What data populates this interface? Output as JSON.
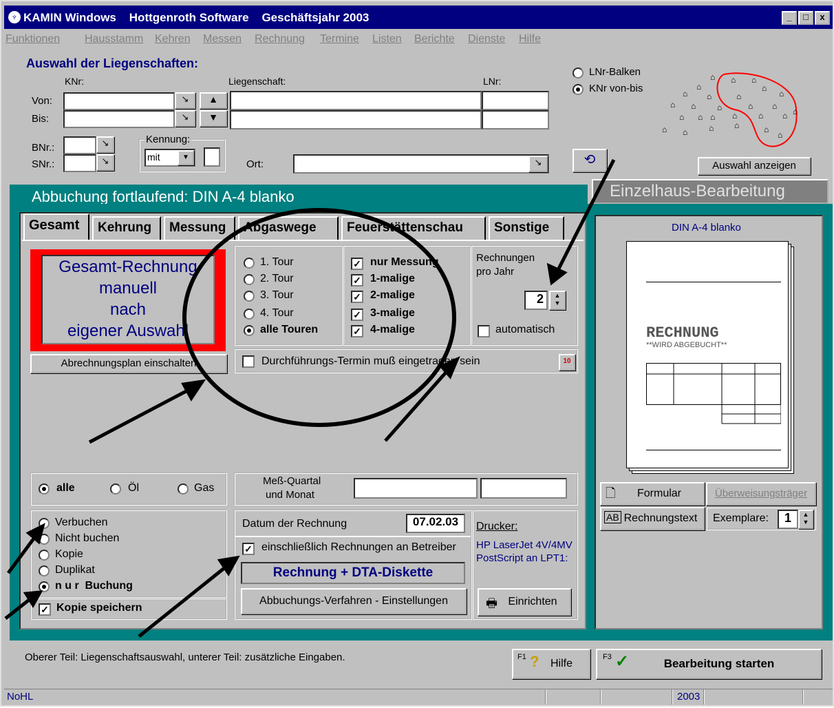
{
  "window": {
    "title": "KAMIN Windows    Hottgenroth Software    Geschäftsjahr 2003",
    "min": "_",
    "max": "□",
    "close": "x"
  },
  "menu": [
    "Funktionen",
    "Hausstamm",
    "Kehren",
    "Messen",
    "Rechnung",
    "Termine",
    "Listen",
    "Berichte",
    "Dienste",
    "Hilfe"
  ],
  "selection": {
    "heading": "Auswahl der Liegenschaften:",
    "col_knr": "KNr:",
    "col_liegenschaft": "Liegenschaft:",
    "col_lnr": "LNr:",
    "von": "Von:",
    "bis": "Bis:",
    "bnr": "BNr.:",
    "snr": "SNr.:",
    "kennung": "Kennung:",
    "kennung_value": "mit",
    "ort": "Ort:",
    "radio_lnr": "LNr-Balken",
    "radio_knr": "KNr von-bis",
    "show_button": "Auswahl anzeigen"
  },
  "mainTab": {
    "title": "Abbuchung fortlaufend: DIN A-4 blanko",
    "other": "Einzelhaus-Bearbeitung"
  },
  "tabs": [
    "Gesamt",
    "Kehrung",
    "Messung",
    "Abgaswege",
    "Feuerstättenschau",
    "Sonstige"
  ],
  "big": [
    "Gesamt-Rechnung",
    "manuell",
    "nach",
    "eigener Auswahl"
  ],
  "plan_button": "Abrechnungsplan einschalten",
  "tours": [
    "1. Tour",
    "2. Tour",
    "3. Tour",
    "4. Tour",
    "alle Touren"
  ],
  "checks": [
    "nur Messung",
    "1-malige",
    "2-malige",
    "3-malige",
    "4-malige"
  ],
  "rpj": {
    "label1": "Rechnungen",
    "label2": "pro Jahr",
    "value": "2",
    "auto": "automatisch"
  },
  "termin": "Durchführungs-Termin muß eingetragen sein",
  "fuel": [
    "alle",
    "Öl",
    "Gas"
  ],
  "quartal": [
    "Meß-Quartal",
    "und Monat"
  ],
  "booking": [
    "Verbuchen",
    "Nicht buchen",
    "Kopie",
    "Duplikat",
    "n u r  Buchung"
  ],
  "kopie": "Kopie speichern",
  "datum": {
    "label": "Datum der Rechnung",
    "value": "07.02.03"
  },
  "betreiber": "einschließlich Rechnungen an Betreiber",
  "rechnung_dta": "Rechnung + DTA-Diskette",
  "abbuchung_btn": "Abbuchungs-Verfahren - Einstellungen",
  "printer": {
    "label": "Drucker:",
    "name": "HP LaserJet 4V/4MV PostScript an LPT1:",
    "setup": "Einrichten"
  },
  "preview": {
    "title": "DIN A-4 blanko",
    "doc_title": "RECHNUNG",
    "doc_sub": "**WIRD ABGEBUCHT**"
  },
  "formular": "Formular",
  "ueberweisung": "Überweisungsträger",
  "rechnungstext": "Rechnungstext",
  "exemplare": "Exemplare:",
  "exemplare_value": "1",
  "hint": "Oberer Teil: Liegenschaftsauswahl,  unterer Teil: zusätzliche Eingaben.",
  "help": {
    "key": "F1",
    "label": "Hilfe"
  },
  "start": {
    "key": "F3",
    "label": "Bearbeitung starten"
  },
  "status": {
    "left": "NoHL",
    "year": "2003"
  },
  "colors": {
    "title": "#000080",
    "tab": "#008080",
    "red": "#ff0000"
  }
}
